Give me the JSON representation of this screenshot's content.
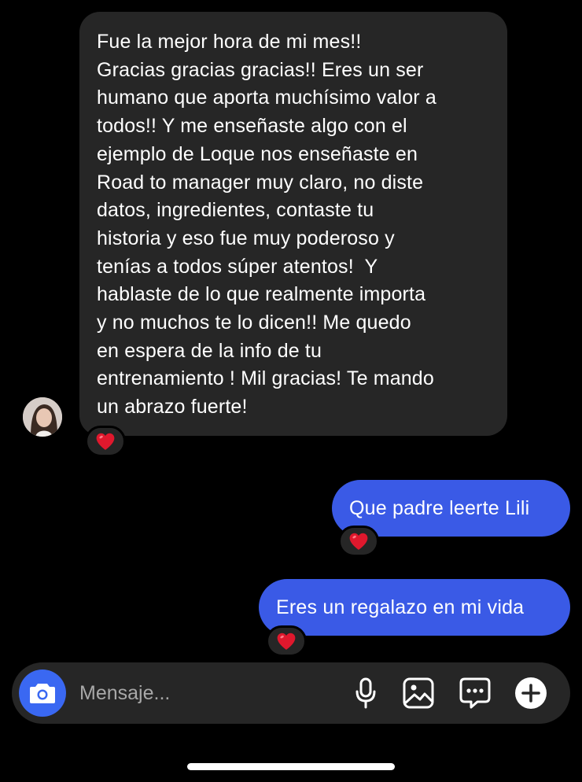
{
  "messages": [
    {
      "direction": "incoming",
      "text": "Fue la mejor hora de mi mes!!\nGracias gracias gracias!! Eres un ser\nhumano que aporta muchísimo valor a\ntodos!! Y me enseñaste algo con el\nejemplo de Loque nos enseñaste en\nRoad to manager muy claro, no diste\ndatos, ingredientes, contaste tu\nhistoria y eso fue muy poderoso y\ntenías a todos súper atentos!  Y\nhablaste de lo que realmente importa\ny no muchos te lo dicen!! Me quedo\nen espera de la info de tu\nentrenamiento ! Mil gracias! Te mando\nun abrazo fuerte!",
      "reaction": "❤️"
    },
    {
      "direction": "outgoing",
      "text": "Que padre leerte Lili",
      "reaction": "❤️"
    },
    {
      "direction": "outgoing",
      "text": "Eres un regalazo en mi vida",
      "reaction": "❤️"
    }
  ],
  "composer": {
    "placeholder": "Mensaje...",
    "icons": [
      "camera-icon",
      "microphone-icon",
      "gallery-icon",
      "sticker-icon",
      "plus-icon"
    ]
  },
  "colors": {
    "background": "#000000",
    "incoming_bubble": "#262626",
    "outgoing_bubble": "#3a5ae6",
    "camera_button": "#3a68f2",
    "heart": "#e0182d"
  }
}
